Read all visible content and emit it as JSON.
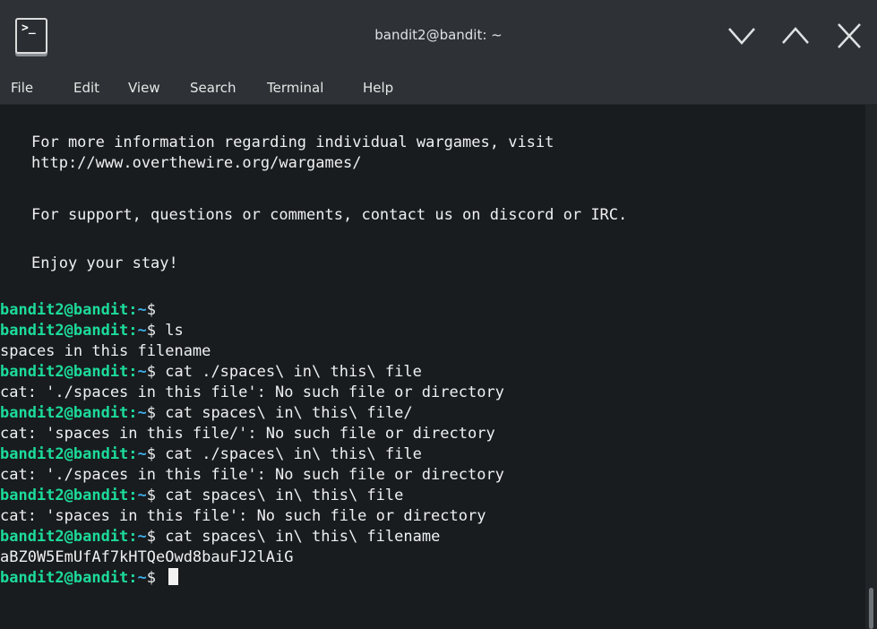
{
  "window": {
    "title": "bandit2@bandit: ~",
    "icon_glyph": ">_",
    "icon": "terminal-icon",
    "controls": [
      "minimize-icon",
      "maximize-icon",
      "close-icon"
    ]
  },
  "menu": {
    "file": "File",
    "edit": "Edit",
    "view": "View",
    "search": "Search",
    "terminal": "Terminal",
    "help": "Help"
  },
  "colors": {
    "prompt": "#1cdc9a",
    "path": "#3daee9",
    "text": "#eff0f1",
    "background": "#191c1f"
  },
  "terminal": {
    "motd": [
      "For more information regarding individual wargames, visit",
      "http://www.overthewire.org/wargames/",
      "For support, questions or comments, contact us on discord or IRC.",
      "Enjoy your stay!"
    ],
    "prompt_user": "bandit2@bandit:",
    "prompt_path": "~",
    "prompt_symbol": "$",
    "lines": [
      {
        "type": "cmd",
        "text": ""
      },
      {
        "type": "cmd",
        "text": " ls"
      },
      {
        "type": "out",
        "text": "spaces in this filename"
      },
      {
        "type": "cmd",
        "text": " cat ./spaces\\ in\\ this\\ file"
      },
      {
        "type": "out",
        "text": "cat: './spaces in this file': No such file or directory"
      },
      {
        "type": "cmd",
        "text": " cat spaces\\ in\\ this\\ file/"
      },
      {
        "type": "out",
        "text": "cat: 'spaces in this file/': No such file or directory"
      },
      {
        "type": "cmd",
        "text": " cat ./spaces\\ in\\ this\\ file"
      },
      {
        "type": "out",
        "text": "cat: './spaces in this file': No such file or directory"
      },
      {
        "type": "cmd",
        "text": " cat spaces\\ in\\ this\\ file"
      },
      {
        "type": "out",
        "text": "cat: 'spaces in this file': No such file or directory"
      },
      {
        "type": "cmd",
        "text": " cat spaces\\ in\\ this\\ filename"
      },
      {
        "type": "out",
        "text": "aBZ0W5EmUfAf7kHTQeOwd8bauFJ2lAiG"
      },
      {
        "type": "cmd",
        "text": " "
      }
    ]
  }
}
